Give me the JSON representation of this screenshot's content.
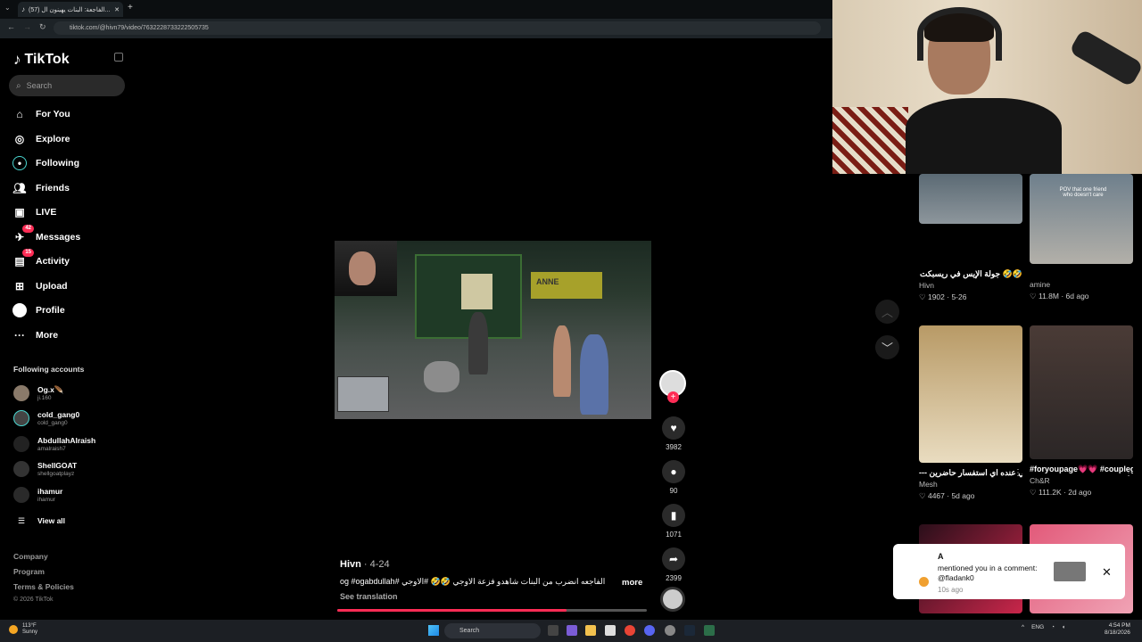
{
  "browser": {
    "tab_title": "(57) الفاجعة: البنات يهينون ال...",
    "url": "tiktok.com/@hivn79/video/7632228733222505735"
  },
  "sidebar": {
    "logo_text": "TikTok",
    "search_placeholder": "Search",
    "nav": [
      {
        "label": "For You",
        "icon": "home-icon"
      },
      {
        "label": "Explore",
        "icon": "compass-icon"
      },
      {
        "label": "Following",
        "icon": "following-icon"
      },
      {
        "label": "Friends",
        "icon": "friends-icon"
      },
      {
        "label": "LIVE",
        "icon": "live-icon"
      },
      {
        "label": "Messages",
        "icon": "messages-icon",
        "badge": "42"
      },
      {
        "label": "Activity",
        "icon": "activity-icon",
        "badge": "15"
      },
      {
        "label": "Upload",
        "icon": "upload-icon"
      },
      {
        "label": "Profile",
        "icon": "profile-icon"
      },
      {
        "label": "More",
        "icon": "more-icon"
      }
    ],
    "following_title": "Following accounts",
    "accounts": [
      {
        "name": "Og.x🪶",
        "handle": "ji.160"
      },
      {
        "name": "cold_gang0",
        "handle": "cold_gang0"
      },
      {
        "name": "AbdullahAlraish",
        "handle": "amalraish7"
      },
      {
        "name": "ShellGOAT",
        "handle": "shellgoatplayz"
      },
      {
        "name": "ihamur",
        "handle": "ihamur"
      }
    ],
    "view_all": "View all",
    "footer": [
      "Company",
      "Program",
      "Terms & Policies"
    ],
    "copyright": "© 2026 TikTok"
  },
  "video": {
    "sign_text": "ANNE",
    "author": "Hivn",
    "date": "· 4-24",
    "caption": "الفاجعه انضرب من البنات شاهدو فزعة الاوجي 🤣🤣 #الاوجي #og #ogabdullah",
    "more_label": "more",
    "see_translation": "See translation",
    "progress_fraction": 0.74
  },
  "actions": {
    "likes": "3982",
    "comments": "90",
    "saves": "1071",
    "shares": "2399"
  },
  "recommendations": [
    {
      "title": "🤣🤣 جولة الإيس في ريسبكت @ogabdullah #الاوجي...",
      "author": "Hivn",
      "meta": "♡ 1902 · 5-26"
    },
    {
      "title": "",
      "author": "amine",
      "meta": "♡ 11.8M · 6d ago",
      "thumb_text": "POV that one friend who doesn't care"
    },
    {
      "title": "--- الي عنده اي استفسار حاضرين ----------------------------...",
      "author": "Mesh",
      "meta": "♡ 4467 · 5d ago"
    },
    {
      "title": "#foryoupage💗💗 #couplegoals #explor...",
      "author": "Ch&R",
      "meta": "♡ 111.2K · 2d ago"
    }
  ],
  "notification": {
    "user": "A",
    "text": "mentioned you in a comment: @fladank0",
    "time": "10s ago"
  },
  "taskbar": {
    "temp": "113°F",
    "weather": "Sunny",
    "search": "Search",
    "lang": "ENG",
    "time": "4:54 PM",
    "date": "8/18/2026"
  },
  "colors": {
    "accent": "#fe2c55"
  }
}
